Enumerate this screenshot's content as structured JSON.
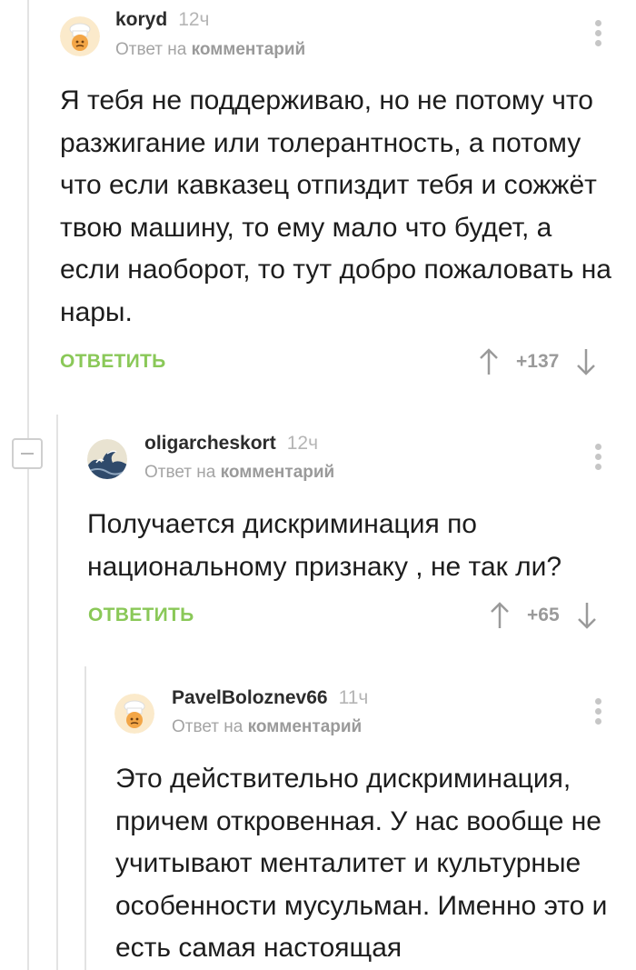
{
  "comments": [
    {
      "username": "koryd",
      "time": "12ч",
      "reply_prefix": "Ответ на",
      "reply_target": "комментарий",
      "text": "Я тебя не поддерживаю, но не потому что разжигание или толерантность, а потому что если кавказец отпиздит тебя и сожжёт твою машину, то ему мало что будет, а если наоборот, то тут добро пожаловать на нары.",
      "reply_label": "ОТВЕТИТЬ",
      "score": "+137",
      "avatar": "chef-avatar"
    },
    {
      "username": "oligarcheskort",
      "time": "12ч",
      "reply_prefix": "Ответ на",
      "reply_target": "комментарий",
      "text": "Получается дискриминация по национальному признаку , не так ли?",
      "reply_label": "ОТВЕТИТЬ",
      "score": "+65",
      "avatar": "great-wave-avatar"
    },
    {
      "username": "PavelBoloznev66",
      "time": "11ч",
      "reply_prefix": "Ответ на",
      "reply_target": "комментарий",
      "text": "Это действительно дискриминация, причем откровенная. У нас вообще не учитывают менталитет и культурные особенности мусульман. Именно это и есть самая настоящая",
      "avatar": "chef-avatar"
    }
  ],
  "colors": {
    "accent_green": "#8ac858",
    "muted_gray": "#a4a4a4",
    "thread_line": "#e3e3e3"
  }
}
